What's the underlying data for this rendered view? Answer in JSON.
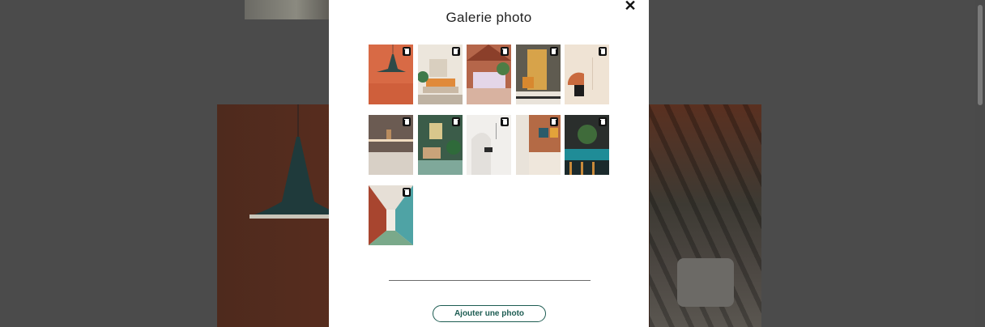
{
  "modal": {
    "title": "Galerie photo",
    "close_label": "✕",
    "add_button_label": "Ajouter une photo"
  },
  "gallery": {
    "photos": [
      {
        "name": "photo-1-pendant-lamp"
      },
      {
        "name": "photo-2-living-room"
      },
      {
        "name": "photo-3-conservatory"
      },
      {
        "name": "photo-4-lounge-screen"
      },
      {
        "name": "photo-5-wall-art"
      },
      {
        "name": "photo-6-kitchen-shelf"
      },
      {
        "name": "photo-7-green-room"
      },
      {
        "name": "photo-8-white-fireplace"
      },
      {
        "name": "photo-9-bathroom-art"
      },
      {
        "name": "photo-10-teal-bar"
      },
      {
        "name": "photo-11-dining-hall"
      }
    ]
  },
  "colors": {
    "accent": "#1d5c52",
    "overlay": "#4b4b4b",
    "modal_bg": "#ffffff"
  }
}
